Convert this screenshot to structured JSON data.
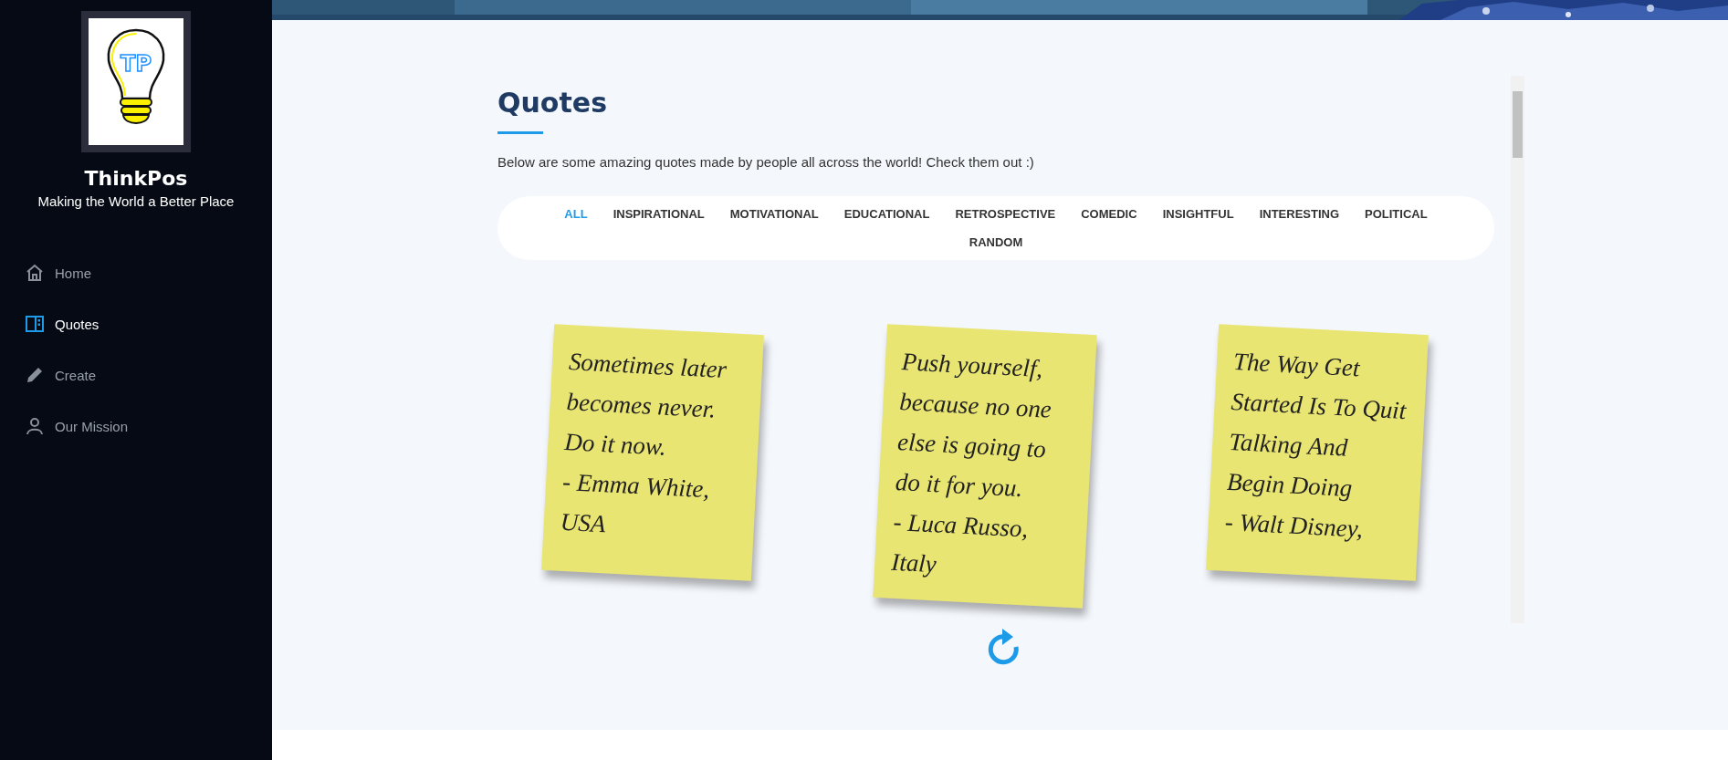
{
  "sidebar": {
    "brand": {
      "logo_text": "TP",
      "title": "ThinkPos",
      "tagline": "Making the World a Better Place"
    },
    "nav": [
      {
        "label": "Home",
        "kind": "home",
        "selected": false
      },
      {
        "label": "Quotes",
        "kind": "book",
        "selected": true
      },
      {
        "label": "Create",
        "kind": "pencil",
        "selected": false
      },
      {
        "label": "Our Mission",
        "kind": "person",
        "selected": false
      }
    ]
  },
  "quotes": {
    "title": "Quotes",
    "intro": "Below are some amazing quotes made by people all across the world! Check them out :)",
    "filters": [
      {
        "label": "ALL",
        "selected": true
      },
      {
        "label": "INSPIRATIONAL",
        "selected": false
      },
      {
        "label": "MOTIVATIONAL",
        "selected": false
      },
      {
        "label": "EDUCATIONAL",
        "selected": false
      },
      {
        "label": "RETROSPECTIVE",
        "selected": false
      },
      {
        "label": "COMEDIC",
        "selected": false
      },
      {
        "label": "INSIGHTFUL",
        "selected": false
      },
      {
        "label": "INTERESTING",
        "selected": false
      },
      {
        "label": "POLITICAL",
        "selected": false
      },
      {
        "label": "RANDOM",
        "selected": false
      }
    ],
    "notes": [
      {
        "text": "Sometimes later becomes never. Do it now.",
        "author": "- Emma White, USA"
      },
      {
        "text": "Push yourself, because no one else is going to do it for you.",
        "author": "- Luca Russo, Italy"
      },
      {
        "text": "The Way Get Started Is To Quit Talking And Begin Doing",
        "author": "- Walt Disney,"
      }
    ]
  }
}
